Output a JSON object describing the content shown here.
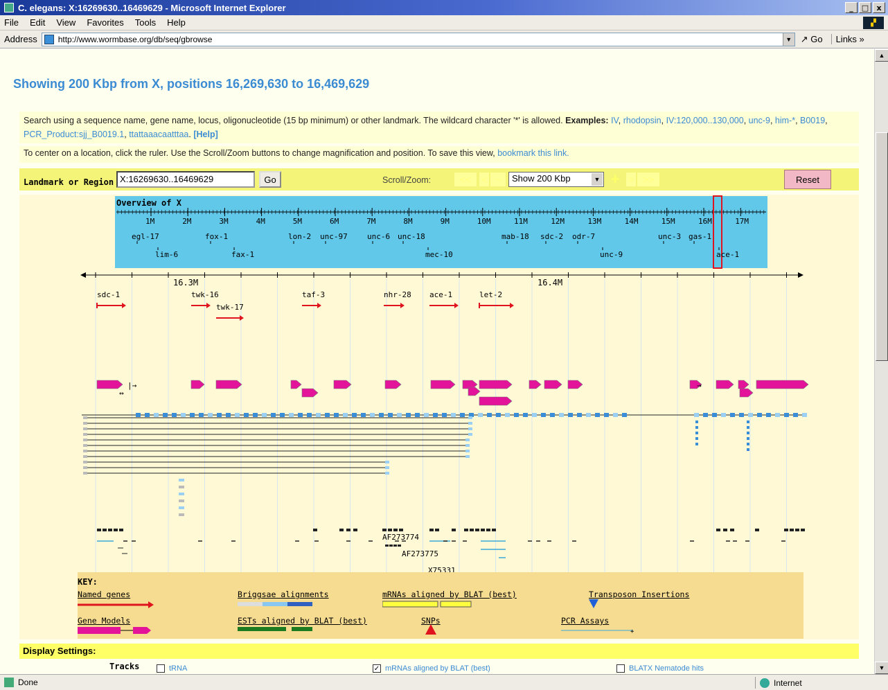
{
  "window": {
    "title": "C. elegans: X:16269630..16469629 - Microsoft Internet Explorer",
    "buttons": [
      "_",
      "□",
      "x"
    ]
  },
  "menu": [
    "File",
    "Edit",
    "View",
    "Favorites",
    "Tools",
    "Help"
  ],
  "address": {
    "label": "Address",
    "url": "http://www.wormbase.org/db/seq/gbrowse",
    "go": "Go",
    "links": "Links"
  },
  "page": {
    "heading": "Showing 200 Kbp from X, positions 16,269,630 to 16,469,629",
    "search_text": "Search using a sequence name, gene name, locus, oligonucleotide (15 bp minimum) or other landmark. The wildcard character '*' is allowed.",
    "examples_label": "Examples:",
    "examples": [
      "IV",
      "rhodopsin",
      "IV:120,000..130,000",
      "unc-9",
      "him-*",
      "B0019",
      "PCR_Product:sjj_B0019.1",
      "ttattaaacaatttaa"
    ],
    "help_link": "[Help]",
    "center_text": "To center on a location, click the ruler. Use the Scroll/Zoom buttons to change magnification and position. To save this view,",
    "bookmark_link": "bookmark this link."
  },
  "nav": {
    "landmark_label": "Landmark or Region",
    "landmark_value": "X:16269630..16469629",
    "go_label": "Go",
    "scroll_zoom_label": "Scroll/Zoom:",
    "zoom_value": "Show 200 Kbp",
    "reset_label": "Reset",
    "zoom_buttons": [
      "<<",
      "<",
      "−",
      "+",
      ">",
      ">>"
    ]
  },
  "overview": {
    "title": "Overview of X",
    "ticks": [
      "1M",
      "2M",
      "3M",
      "4M",
      "5M",
      "6M",
      "7M",
      "8M",
      "9M",
      "10M",
      "11M",
      "12M",
      "13M",
      "14M",
      "15M",
      "16M",
      "17M"
    ],
    "genes_row1": [
      "egl-17",
      "fox-1",
      "lon-2",
      "unc-97",
      "unc-6",
      "unc-18",
      "mab-18",
      "sdc-2",
      "odr-7",
      "unc-3",
      "gas-1"
    ],
    "genes_row2": [
      "lim-6",
      "fax-1",
      "mec-10",
      "unc-9",
      "ace-1"
    ],
    "highlight_color": "#e0141e",
    "bg_color": "#62c8ea"
  },
  "detail": {
    "ruler_labels": [
      "16.3M",
      "16.4M"
    ],
    "named_genes": [
      "sdc-1",
      "twk-16",
      "twk-17",
      "taf-3",
      "nhr-28",
      "ace-1",
      "let-2"
    ],
    "mrna_labels": [
      "AF273774",
      "AF273775",
      "X75331"
    ],
    "gene_color": "#e3139a",
    "arrow_color": "#e0141e"
  },
  "key": {
    "title": "KEY:",
    "items": [
      "Named genes",
      "Briggsae alignments",
      "mRNAs aligned by BLAT (best)",
      "Transposon Insertions",
      "Gene Models",
      "ESTs aligned by BLAT (best)",
      "SNPs",
      "PCR Assays"
    ]
  },
  "settings": {
    "title": "Display Settings:",
    "tracks_label": "Tracks",
    "track_options": [
      {
        "label": "tRNA",
        "checked": false
      },
      {
        "label": "mRNAs aligned by BLAT (best)",
        "checked": true
      },
      {
        "label": "BLATX Nematode hits",
        "checked": false
      }
    ]
  },
  "status": {
    "text": "Done",
    "zone": "Internet"
  }
}
